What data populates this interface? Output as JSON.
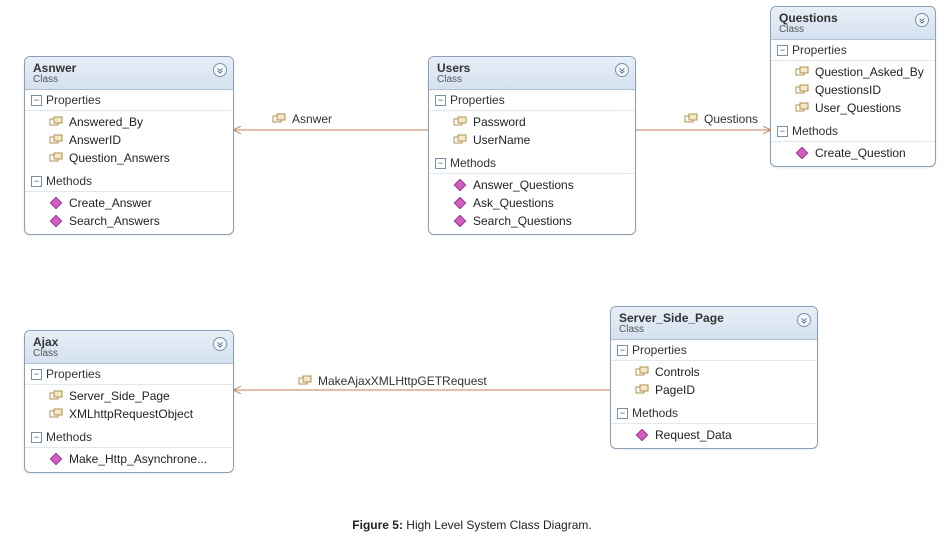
{
  "caption": {
    "label": "Figure 5:",
    "text": "High Level System Class Diagram."
  },
  "classes": {
    "answer": {
      "name": "Asnwer",
      "kind": "Class",
      "properties_label": "Properties",
      "methods_label": "Methods",
      "properties": [
        "Answered_By",
        "AnswerID",
        "Question_Answers"
      ],
      "methods": [
        "Create_Answer",
        "Search_Answers"
      ]
    },
    "users": {
      "name": "Users",
      "kind": "Class",
      "properties_label": "Properties",
      "methods_label": "Methods",
      "properties": [
        "Password",
        "UserName"
      ],
      "methods": [
        "Answer_Questions",
        "Ask_Questions",
        "Search_Questions"
      ]
    },
    "questions": {
      "name": "Questions",
      "kind": "Class",
      "properties_label": "Properties",
      "methods_label": "Methods",
      "properties": [
        "Question_Asked_By",
        "QuestionsID",
        "User_Questions"
      ],
      "methods": [
        "Create_Question"
      ]
    },
    "ajax": {
      "name": "Ajax",
      "kind": "Class",
      "properties_label": "Properties",
      "methods_label": "Methods",
      "properties": [
        "Server_Side_Page",
        "XMLhttpRequestObject"
      ],
      "methods": [
        "Make_Http_Asynchrone..."
      ]
    },
    "server": {
      "name": "Server_Side_Page",
      "kind": "Class",
      "properties_label": "Properties",
      "methods_label": "Methods",
      "properties": [
        "Controls",
        "PageID"
      ],
      "methods": [
        "Request_Data"
      ]
    }
  },
  "associations": {
    "users_to_answer": "Asnwer",
    "users_to_questions": "Questions",
    "server_to_ajax": "MakeAjaxXMLHttpGETRequest"
  },
  "chart_data": {
    "type": "uml-class-diagram",
    "title": "High Level System Class Diagram",
    "classes": [
      {
        "name": "Asnwer",
        "kind": "Class",
        "properties": [
          "Answered_By",
          "AnswerID",
          "Question_Answers"
        ],
        "methods": [
          "Create_Answer",
          "Search_Answers"
        ]
      },
      {
        "name": "Users",
        "kind": "Class",
        "properties": [
          "Password",
          "UserName"
        ],
        "methods": [
          "Answer_Questions",
          "Ask_Questions",
          "Search_Questions"
        ]
      },
      {
        "name": "Questions",
        "kind": "Class",
        "properties": [
          "Question_Asked_By",
          "QuestionsID",
          "User_Questions"
        ],
        "methods": [
          "Create_Question"
        ]
      },
      {
        "name": "Ajax",
        "kind": "Class",
        "properties": [
          "Server_Side_Page",
          "XMLhttpRequestObject"
        ],
        "methods": [
          "Make_Http_Asynchrone..."
        ]
      },
      {
        "name": "Server_Side_Page",
        "kind": "Class",
        "properties": [
          "Controls",
          "PageID"
        ],
        "methods": [
          "Request_Data"
        ]
      }
    ],
    "associations": [
      {
        "from": "Users",
        "to": "Asnwer",
        "label": "Asnwer",
        "direction": "to"
      },
      {
        "from": "Users",
        "to": "Questions",
        "label": "Questions",
        "direction": "to"
      },
      {
        "from": "Server_Side_Page",
        "to": "Ajax",
        "label": "MakeAjaxXMLHttpGETRequest",
        "direction": "to"
      }
    ]
  }
}
